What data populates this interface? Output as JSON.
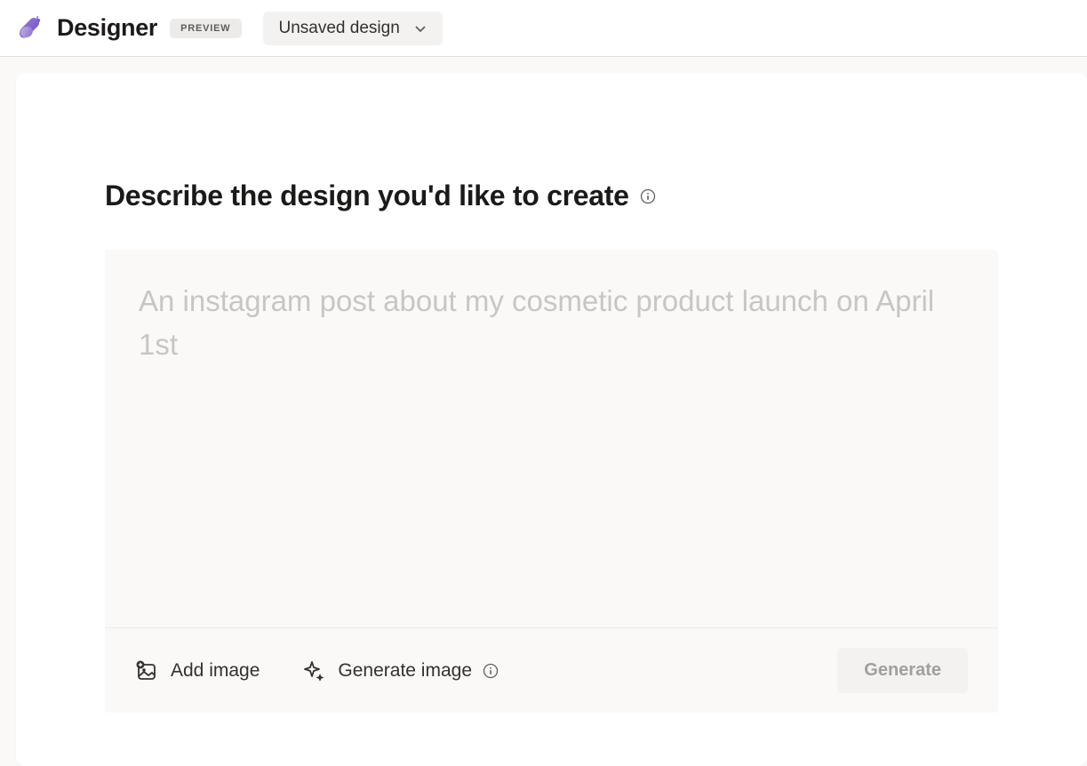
{
  "header": {
    "app_title": "Designer",
    "preview_badge": "PREVIEW",
    "design_name": "Unsaved design"
  },
  "main": {
    "heading": "Describe the design you'd like to create",
    "prompt_placeholder": "An instagram post about my cosmetic product launch on April 1st",
    "toolbar": {
      "add_image_label": "Add image",
      "generate_image_label": "Generate image",
      "generate_button_label": "Generate"
    }
  }
}
